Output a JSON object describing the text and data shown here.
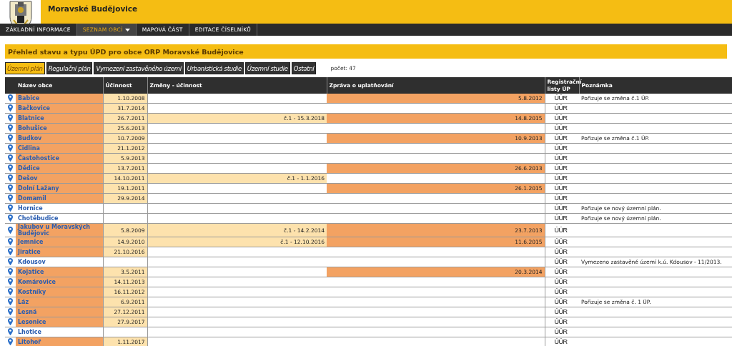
{
  "site": {
    "title": "Moravské Budějovice"
  },
  "nav": [
    {
      "label": "ZÁKLADNÍ INFORMACE",
      "selected": false,
      "dropdown": false
    },
    {
      "label": "SEZNAM OBCÍ",
      "selected": true,
      "dropdown": true
    },
    {
      "label": "MAPOVÁ ČÁST",
      "selected": false,
      "dropdown": false
    },
    {
      "label": "EDITACE ČÍSELNÍKŮ",
      "selected": false,
      "dropdown": false
    }
  ],
  "heading": "Přehled stavu a typu ÚPD pro obce ORP Moravské Budějovice",
  "tabs": [
    {
      "label": "Územní plán",
      "selected": true
    },
    {
      "label": "Regulační plán",
      "selected": false
    },
    {
      "label": "Vymezení zastavěného území",
      "selected": false
    },
    {
      "label": "Urbanistická studie",
      "selected": false
    },
    {
      "label": "Územní studie",
      "selected": false
    },
    {
      "label": "Ostatní",
      "selected": false
    }
  ],
  "count": "počet: 47",
  "table": {
    "columns": [
      "Název obce",
      "Účinnost",
      "Změny - účinnost",
      "Zpráva o uplatňování",
      "Registrační listy ÚP",
      "Poznámka"
    ],
    "rows": [
      {
        "name": "Babice",
        "effective": "1.10.2008",
        "changes": "",
        "report": "5.8.2012",
        "registry": "ÚÚR",
        "note": "Pořizuje se změna č.1 ÚP."
      },
      {
        "name": "Bačkovice",
        "effective": "31.7.2014",
        "changes": "",
        "report": "",
        "registry": "ÚÚR",
        "note": ""
      },
      {
        "name": "Blatnice",
        "effective": "26.7.2011",
        "changes": "č.1 - 15.3.2018",
        "report": "14.8.2015",
        "registry": "ÚÚR",
        "note": ""
      },
      {
        "name": "Bohušice",
        "effective": "25.6.2013",
        "changes": "",
        "report": "",
        "registry": "ÚÚR",
        "note": ""
      },
      {
        "name": "Budkov",
        "effective": "10.7.2009",
        "changes": "",
        "report": "10.9.2013",
        "registry": "ÚÚR",
        "note": "Pořizuje se změna č.1 ÚP."
      },
      {
        "name": "Cidlina",
        "effective": "21.1.2012",
        "changes": "",
        "report": "",
        "registry": "ÚÚR",
        "note": ""
      },
      {
        "name": "Častohostice",
        "effective": "5.9.2013",
        "changes": "",
        "report": "",
        "registry": "ÚÚR",
        "note": ""
      },
      {
        "name": "Dědice",
        "effective": "13.7.2011",
        "changes": "",
        "report": "26.6.2013",
        "registry": "ÚÚR",
        "note": ""
      },
      {
        "name": "Dešov",
        "effective": "14.10.2011",
        "changes": "č.1 - 1.1.2016",
        "report": "",
        "registry": "ÚÚR",
        "note": ""
      },
      {
        "name": "Dolní Lažany",
        "effective": "19.1.2011",
        "changes": "",
        "report": "26.1.2015",
        "registry": "ÚÚR",
        "note": ""
      },
      {
        "name": "Domamil",
        "effective": "29.9.2014",
        "changes": "",
        "report": "",
        "registry": "ÚÚR",
        "note": ""
      },
      {
        "name": "Hornice",
        "effective": "",
        "changes": "",
        "report": "",
        "registry": "ÚÚR",
        "note": "Pořizuje se nový územní plán."
      },
      {
        "name": "Chotěbudice",
        "effective": "",
        "changes": "",
        "report": "",
        "registry": "ÚÚR",
        "note": "Pořizuje se nový územní plán."
      },
      {
        "name": "Jakubov u Moravských Budějovic",
        "effective": "5.8.2009",
        "changes": "č.1 - 14.2.2014",
        "report": "23.7.2013",
        "registry": "ÚÚR",
        "note": ""
      },
      {
        "name": "Jemnice",
        "effective": "14.9.2010",
        "changes": "č.1 - 12.10.2016",
        "report": "11.6.2015",
        "registry": "ÚÚR",
        "note": ""
      },
      {
        "name": "Jiratice",
        "effective": "21.10.2016",
        "changes": "",
        "report": "",
        "registry": "ÚÚR",
        "note": ""
      },
      {
        "name": "Kdousov",
        "effective": "",
        "changes": "",
        "report": "",
        "registry": "ÚÚR",
        "note": "Vymezeno zastavěné území k.ú. Kdousov - 11/2013."
      },
      {
        "name": "Kojatice",
        "effective": "3.5.2011",
        "changes": "",
        "report": "20.3.2014",
        "registry": "ÚÚR",
        "note": ""
      },
      {
        "name": "Komárovice",
        "effective": "14.11.2013",
        "changes": "",
        "report": "",
        "registry": "ÚÚR",
        "note": ""
      },
      {
        "name": "Kostníky",
        "effective": "16.11.2012",
        "changes": "",
        "report": "",
        "registry": "ÚÚR",
        "note": ""
      },
      {
        "name": "Láz",
        "effective": "6.9.2011",
        "changes": "",
        "report": "",
        "registry": "ÚÚR",
        "note": "Pořizuje se změna č. 1 ÚP."
      },
      {
        "name": "Lesná",
        "effective": "27.12.2011",
        "changes": "",
        "report": "",
        "registry": "ÚÚR",
        "note": ""
      },
      {
        "name": "Lesonice",
        "effective": "27.9.2017",
        "changes": "",
        "report": "",
        "registry": "ÚÚR",
        "note": ""
      },
      {
        "name": "Lhotice",
        "effective": "",
        "changes": "",
        "report": "",
        "registry": "ÚÚR",
        "note": ""
      },
      {
        "name": "Litohoř",
        "effective": "1.11.2017",
        "changes": "",
        "report": "",
        "registry": "ÚÚR",
        "note": ""
      }
    ]
  }
}
